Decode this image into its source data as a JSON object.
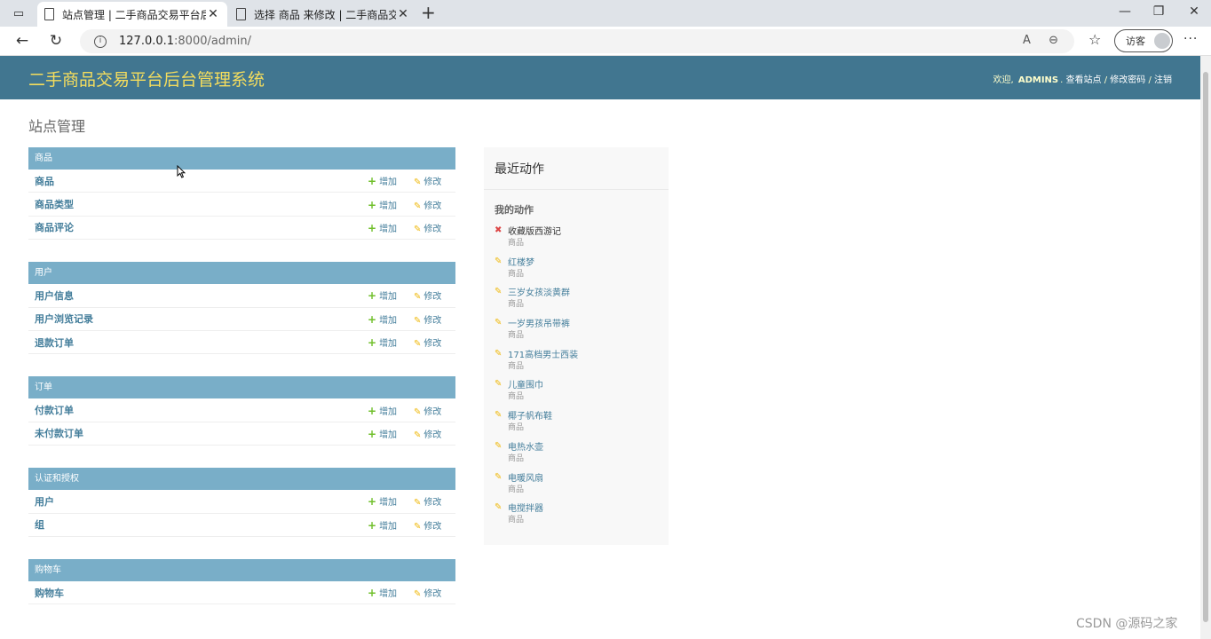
{
  "browser": {
    "tabs": [
      {
        "title": "站点管理 | 二手商品交易平台后台"
      },
      {
        "title": "选择 商品 来修改 | 二手商品交易"
      }
    ],
    "url_host": "127.0.0.1",
    "url_path": ":8000/admin/",
    "profile_label": "访客"
  },
  "header": {
    "branding": "二手商品交易平台后台管理系统",
    "welcome": "欢迎,",
    "user": "ADMINS",
    "view_site": "查看站点",
    "change_password": "修改密码",
    "logout": "注销",
    "sep": "/"
  },
  "page_title": "站点管理",
  "action_add": "增加",
  "action_change": "修改",
  "modules": [
    {
      "caption": "商品",
      "models": [
        "商品",
        "商品类型",
        "商品评论"
      ]
    },
    {
      "caption": "用户",
      "models": [
        "用户信息",
        "用户浏览记录",
        "退款订单"
      ]
    },
    {
      "caption": "订单",
      "models": [
        "付款订单",
        "未付款订单"
      ]
    },
    {
      "caption": "认证和授权",
      "models": [
        "用户",
        "组"
      ]
    },
    {
      "caption": "购物车",
      "models": [
        "购物车"
      ]
    }
  ],
  "recent": {
    "title": "最近动作",
    "subtitle": "我的动作",
    "items": [
      {
        "label": "收藏版西游记",
        "type": "商品",
        "kind": "delete"
      },
      {
        "label": "红楼梦",
        "type": "商品",
        "kind": "change"
      },
      {
        "label": "三岁女孩淡黄群",
        "type": "商品",
        "kind": "change"
      },
      {
        "label": "一岁男孩吊带裤",
        "type": "商品",
        "kind": "change"
      },
      {
        "label": "171高档男士西装",
        "type": "商品",
        "kind": "change"
      },
      {
        "label": "儿童围巾",
        "type": "商品",
        "kind": "change"
      },
      {
        "label": "椰子帆布鞋",
        "type": "商品",
        "kind": "change"
      },
      {
        "label": "电热水壶",
        "type": "商品",
        "kind": "change"
      },
      {
        "label": "电暖风扇",
        "type": "商品",
        "kind": "change"
      },
      {
        "label": "电搅拌器",
        "type": "商品",
        "kind": "change"
      }
    ]
  },
  "watermark": "CSDN @源码之家"
}
